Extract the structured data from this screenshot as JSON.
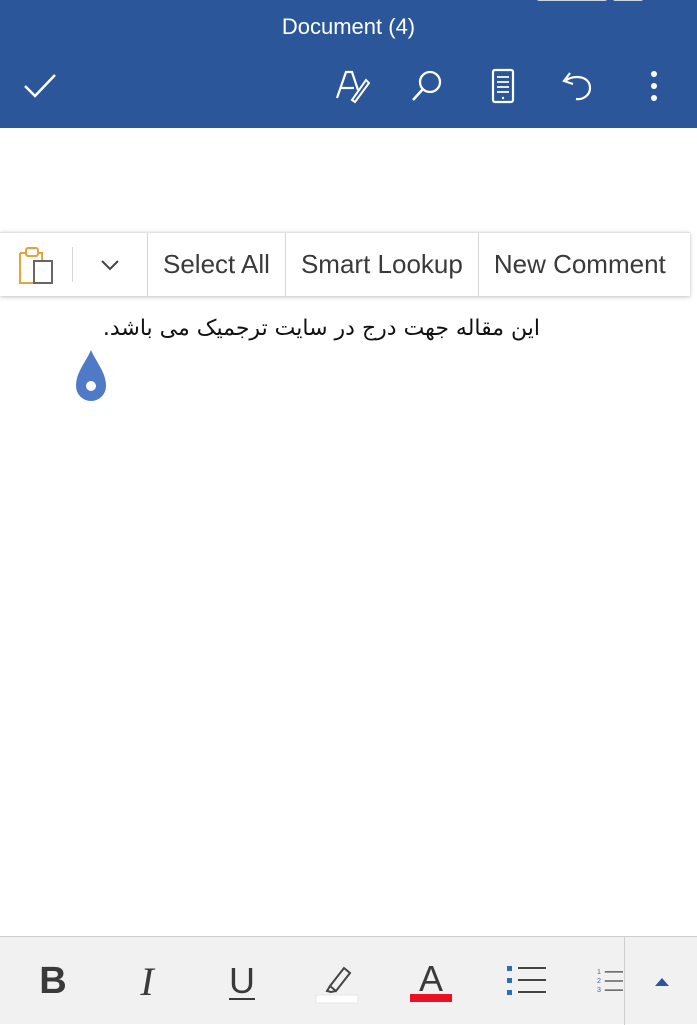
{
  "header": {
    "title": "Document (4)"
  },
  "toolbar": {
    "icons": [
      "check-icon",
      "pen-format-icon",
      "search-icon",
      "reading-view-icon",
      "undo-icon",
      "more-vertical-icon"
    ]
  },
  "context_menu": {
    "select_all": "Select All",
    "smart_lookup": "Smart Lookup",
    "new_comment": "New Comment"
  },
  "document": {
    "text": "این مقاله جهت درج در سایت ترجمیک می باشد."
  },
  "format_bar": {
    "bold": "B",
    "italic": "I",
    "underline": "U",
    "font_color_glyph": "A",
    "numbered_list_digits": [
      "1",
      "2",
      "3"
    ]
  },
  "colors": {
    "accent": "#2b579a",
    "font_color": "#e81123",
    "paste_icon": "#e8a33d",
    "bullet": "#2b6fb8"
  }
}
